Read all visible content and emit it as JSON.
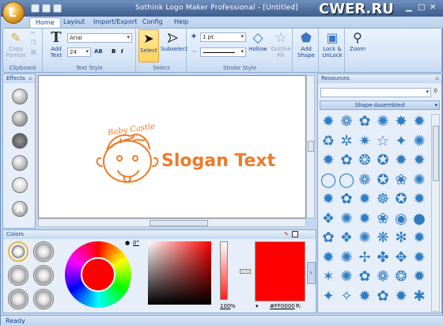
{
  "window": {
    "title": "Sothink Logo Maker Professional - [Untitled]",
    "watermark": "CWER.RU"
  },
  "menu_tabs": [
    "Home",
    "Layout",
    "Import/Export",
    "Config",
    "Help"
  ],
  "ribbon": {
    "clipboard": {
      "group": "Clipboard",
      "copy_format": "Copy Format"
    },
    "text_style": {
      "group": "Text Style",
      "add_text": "Add Text",
      "font": "Arial",
      "size": "24",
      "bold": "B",
      "italic": "I",
      "ab": "AB"
    },
    "select": {
      "group": "Select",
      "select": "Select",
      "subselect": "Subselect"
    },
    "stroke": {
      "group": "Stroke Style",
      "width": "1 pt",
      "hollow": "Hollow",
      "outline_fill": "Outline Fill"
    },
    "arrange": {
      "add_shape": "Add Shape",
      "lock": "Lock & UnLock",
      "zoom": "Zoom"
    }
  },
  "effects": {
    "title": "Effects"
  },
  "logo": {
    "tagline": "Baby Castle",
    "slogan": "Slogan Text",
    "color": "#f07b2a"
  },
  "resources": {
    "title": "Resources",
    "search_placeholder": "",
    "category": "Shape-Assembled",
    "shape_color": "#2f7ec4",
    "shapes": [
      "✹",
      "❁",
      "✿",
      "✺",
      "✸",
      "✹",
      "♻",
      "✲",
      "✷",
      "☆",
      "✦",
      "✺",
      "✹",
      "✿",
      "❂",
      "✪",
      "✹",
      "✹",
      "◯",
      "◯",
      "❁",
      "✪",
      "❀",
      "✺",
      "✹",
      "✿",
      "✹",
      "☸",
      "✪",
      "✹",
      "❖",
      "✺",
      "✹",
      "❀",
      "◉",
      "●",
      "✿",
      "❖",
      "✺",
      "❋",
      "✻",
      "✹",
      "✹",
      "✺",
      "✢",
      "✤",
      "✥",
      "✹",
      "✶",
      "✺",
      "✿",
      "❁",
      "❂",
      "✹",
      "✦",
      "✧",
      "✹",
      "✿",
      "✹",
      "✱"
    ]
  },
  "colors": {
    "title": "Colors",
    "angle": "0°",
    "opacity": "100",
    "opacity_unit": "%",
    "hex": "#FF0000",
    "rgb_prefix": "R:",
    "current": "#ff0000"
  },
  "status": {
    "text": "Ready"
  }
}
